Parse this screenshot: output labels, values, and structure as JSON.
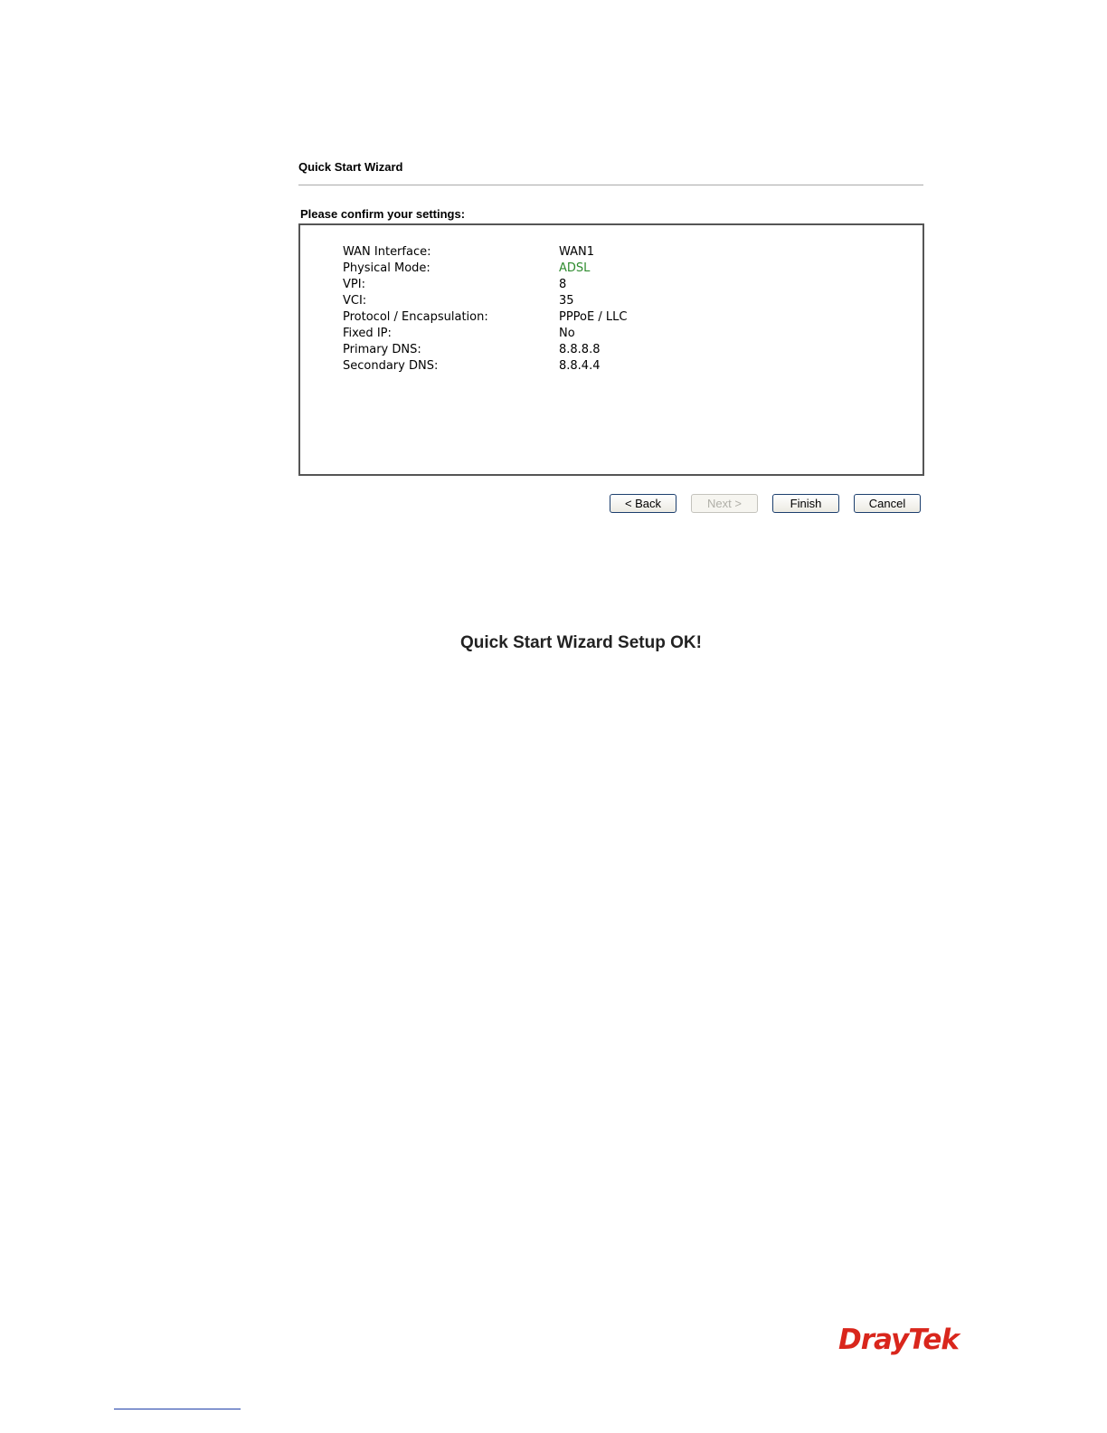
{
  "wizard": {
    "title": "Quick Start Wizard",
    "confirm_heading": "Please confirm your settings:"
  },
  "settings": [
    {
      "label": "WAN Interface:",
      "value": "WAN1"
    },
    {
      "label": "Physical Mode:",
      "value": "ADSL"
    },
    {
      "label": "VPI:",
      "value": "8"
    },
    {
      "label": "VCI:",
      "value": "35"
    },
    {
      "label": "Protocol / Encapsulation:",
      "value": "PPPoE / LLC"
    },
    {
      "label": "Fixed IP:",
      "value": "No"
    },
    {
      "label": "Primary DNS:",
      "value": "8.8.8.8"
    },
    {
      "label": "Secondary DNS:",
      "value": "8.8.4.4"
    }
  ],
  "buttons": {
    "back": "< Back",
    "next": "Next >",
    "finish": "Finish",
    "cancel": "Cancel"
  },
  "result": {
    "message": "Quick Start Wizard Setup OK!"
  },
  "logo": {
    "text": "DrayTek"
  },
  "colors": {
    "physical_mode_value": "#2e8b2e",
    "logo": "#d9261c",
    "button_border": "#1c3f6e"
  }
}
